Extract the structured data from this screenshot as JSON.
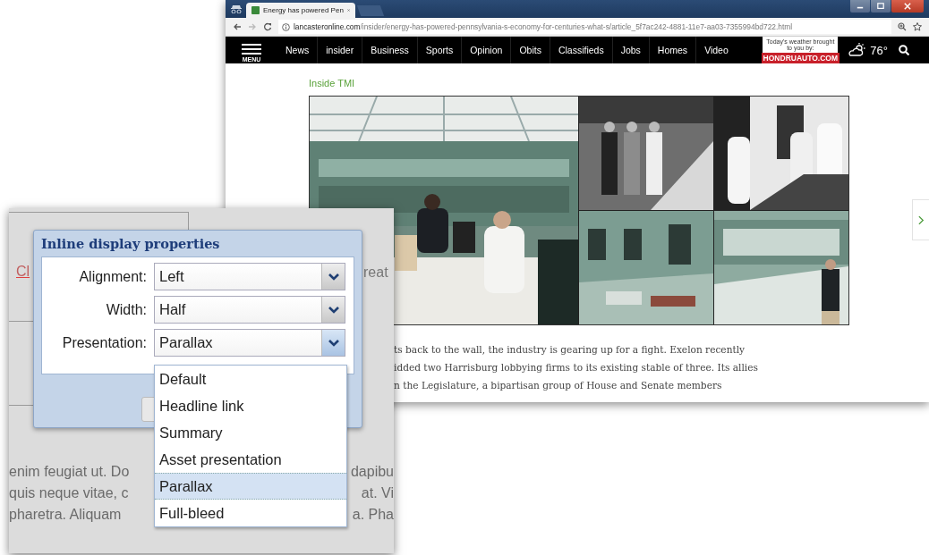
{
  "browser": {
    "tab_title": "Energy has powered Pen",
    "url_domain": "lancasteronline.com",
    "url_path": "/insider/energy-has-powered-pennsylvania-s-economy-for-centuries-what-s/article_5f7ac242-4881-11e7-aa03-7355994bd722.html",
    "menu_label": "MENU",
    "nav": [
      "News",
      "insider",
      "Business",
      "Sports",
      "Opinion",
      "Obits",
      "Classifieds",
      "Jobs",
      "Homes",
      "Video"
    ],
    "ad": {
      "caption": "Today's weather brought to you by:",
      "brand": "HONDRUAUTO.COM"
    },
    "weather": "76°",
    "section": "Inside TMI",
    "article_lines": [
      "ts back to the wall, the industry is gearing up for a fight. Exelon recently",
      "idded two Harrisburg lobbying firms to its existing stable of three. Its allies",
      "n the Legislature, a bipartisan group of House and Senate members"
    ]
  },
  "dialog": {
    "behind": {
      "link_fragment": "Cl",
      "side_fragment": "reat",
      "lines": [
        {
          "left": "enim feugiat ut. Do",
          "right": "dapibu"
        },
        {
          "left": "quis neque vitae, c",
          "right": "at. Vi"
        },
        {
          "left": "pharetra. Aliquam",
          "right": "a. Pha"
        }
      ]
    },
    "title": "Inline display properties",
    "fields": [
      {
        "label": "Alignment:",
        "value": "Left",
        "open": false
      },
      {
        "label": "Width:",
        "value": "Half",
        "open": false
      },
      {
        "label": "Presentation:",
        "value": "Parallax",
        "open": true
      }
    ],
    "options": [
      {
        "label": "Default",
        "selected": false
      },
      {
        "label": "Headline link",
        "selected": false
      },
      {
        "label": "Summary",
        "selected": false
      },
      {
        "label": "Asset presentation",
        "selected": false
      },
      {
        "label": "Parallax",
        "selected": true
      },
      {
        "label": "Full-bleed",
        "selected": false
      }
    ]
  }
}
